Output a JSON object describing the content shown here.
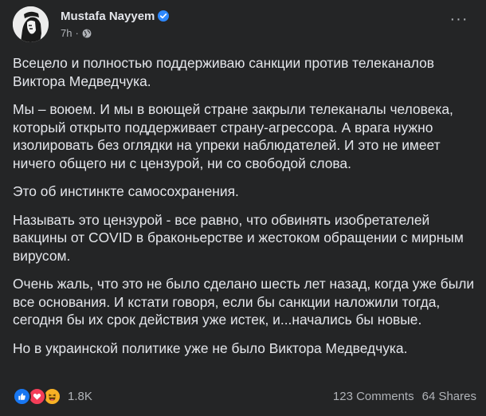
{
  "post": {
    "author": "Mustafa Nayyem",
    "timestamp": "7h",
    "paragraphs": [
      "Всецело и полностью поддерживаю санкции против телеканалов Виктора Медведчука.",
      "Мы – воюем. И мы в воющей стране закрыли телеканалы человека, который открыто поддерживает страну-агрессора. А врага нужно изолировать без оглядки на упреки наблюдателей. И это не имеет ничего общего ни с цензурой, ни со свободой слова.",
      "Это об инстинкте самосохранения.",
      "Называть это цензурой - все равно, что обвинять изобретателей вакцины от COVID в браконьерстве и жестоком обращении с мирным вирусом.",
      "Очень жаль, что это не было сделано шесть лет назад, когда уже были все основания. И кстати говоря, если бы санкции наложили тогда, сегодня бы их срок действия уже истек, и...начались бы новые.",
      "Но в украинской политике уже не было Виктора Медведчука."
    ]
  },
  "footer": {
    "reaction_count": "1.8K",
    "comments": "123 Comments",
    "shares": "64 Shares",
    "reactions": [
      "like-icon",
      "love-icon",
      "haha-icon"
    ]
  },
  "colors": {
    "background": "#242526",
    "text": "#e4e6eb",
    "secondary_text": "#b0b3b8",
    "verified": "#2d88ff",
    "like": "#1877f2",
    "love": "#f33e58",
    "haha": "#f7b125"
  }
}
